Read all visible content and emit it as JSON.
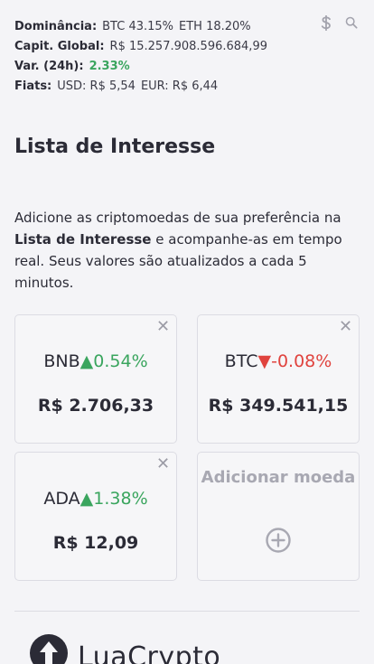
{
  "stats": {
    "dominance_label": "Dominância:",
    "dominance_btc": "BTC 43.15%",
    "dominance_eth": "ETH 18.20%",
    "market_cap_label": "Capit. Global:",
    "market_cap_value": "R$ 15.257.908.596.684,99",
    "change_label": "Var. (24h):",
    "change_value": "2.33%",
    "fiats_label": "Fiats:",
    "fiats_usd": "USD: R$ 5,54",
    "fiats_eur": "EUR: R$ 6,44"
  },
  "icons": {
    "currency": "dollar-icon",
    "search": "search-icon",
    "close": "close-icon",
    "add": "plus-circle-icon"
  },
  "page": {
    "title": "Lista de Interesse",
    "intro_before": "Adicione as criptomoedas de sua preferência na",
    "intro_bold": "Lista de Interesse",
    "intro_after": "e acompanhe-as em tempo real. Seus valores são atualizados a cada 5 minutos."
  },
  "watchlist": [
    {
      "symbol": "BNB",
      "direction": "up",
      "change": "0.54%",
      "price": "R$ 2.706,33"
    },
    {
      "symbol": "BTC",
      "direction": "down",
      "change": "-0.08%",
      "price": "R$ 349.541,15"
    },
    {
      "symbol": "ADA",
      "direction": "up",
      "change": "1.38%",
      "price": "R$ 12,09"
    }
  ],
  "add_card": {
    "label": "Adicionar moeda"
  },
  "footer": {
    "brand": "LuaCrypto"
  },
  "colors": {
    "up": "#3aa55e",
    "down": "#e0433e",
    "muted": "#a8a8b2",
    "text": "#2b2b36"
  }
}
